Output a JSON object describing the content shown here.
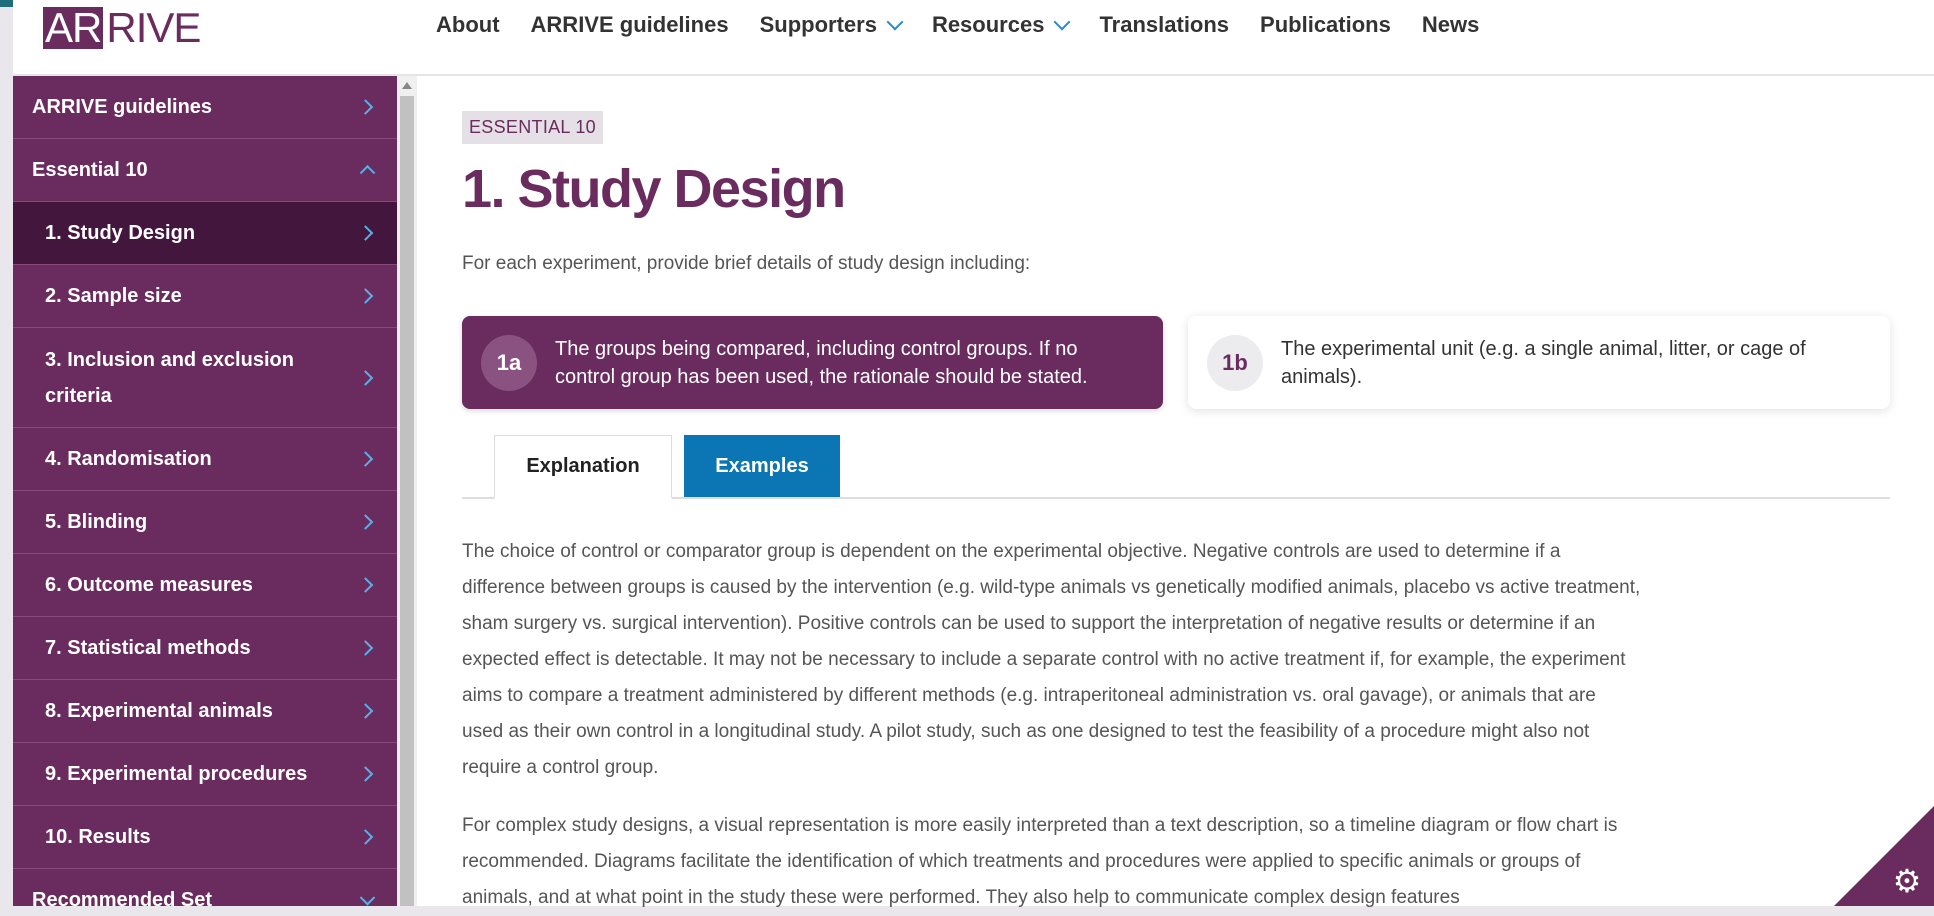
{
  "logo": {
    "part1": "AR",
    "part2": "RIVE"
  },
  "nav": {
    "items": [
      {
        "label": "About",
        "dropdown": false
      },
      {
        "label": "ARRIVE guidelines",
        "dropdown": false
      },
      {
        "label": "Supporters",
        "dropdown": true
      },
      {
        "label": "Resources",
        "dropdown": true
      },
      {
        "label": "Translations",
        "dropdown": false
      },
      {
        "label": "Publications",
        "dropdown": false
      },
      {
        "label": "News",
        "dropdown": false
      }
    ]
  },
  "sidebar": {
    "items": [
      {
        "label": "ARRIVE guidelines"
      },
      {
        "label": "Essential 10"
      },
      {
        "label": "1. Study Design"
      },
      {
        "label": "2. Sample size"
      },
      {
        "label": "3. Inclusion and exclusion criteria"
      },
      {
        "label": "4. Randomisation"
      },
      {
        "label": "5. Blinding"
      },
      {
        "label": "6. Outcome measures"
      },
      {
        "label": "7. Statistical methods"
      },
      {
        "label": "8. Experimental animals"
      },
      {
        "label": "9. Experimental procedures"
      },
      {
        "label": "10. Results"
      },
      {
        "label": "Recommended Set"
      }
    ]
  },
  "content": {
    "badge": "ESSENTIAL 10",
    "title": "1. Study Design",
    "intro": "For each experiment, provide brief details of study design including:",
    "cards": [
      {
        "id": "1a",
        "text": "The groups being compared, including control groups. If no control group has been used, the rationale should be stated."
      },
      {
        "id": "1b",
        "text": "The experimental unit (e.g. a single animal, litter, or cage of animals)."
      }
    ],
    "tabs": [
      {
        "label": "Explanation"
      },
      {
        "label": "Examples"
      }
    ],
    "paragraphs": [
      "The choice of control or comparator group is dependent on the experimental objective. Negative controls are used to determine if a difference between groups is caused by the intervention (e.g. wild-type animals vs genetically modified animals, placebo vs active treatment, sham surgery vs. surgical intervention). Positive controls can be used to support the interpretation of negative results or determine if an expected effect is detectable.  It may not be necessary to include a separate control with no active treatment if, for example, the experiment aims to compare a treatment administered by different methods (e.g. intraperitoneal administration vs. oral gavage), or animals that are used as their own control in a longitudinal study. A pilot study, such as one designed to test the feasibility of a procedure might also not require a control group.",
      "For complex study designs, a visual representation is more easily interpreted than a text description, so a timeline diagram or flow chart is recommended. Diagrams facilitate the identification of which treatments and procedures were applied to specific animals or groups of animals, and at what point in the study these were performed. They also help to communicate complex design features"
    ]
  },
  "icons": {
    "settings": "gear-icon"
  },
  "colors": {
    "brand": "#6a2c5f",
    "active": "#43173d",
    "accent": "#0b76b3",
    "chevron": "#58b0e6"
  }
}
